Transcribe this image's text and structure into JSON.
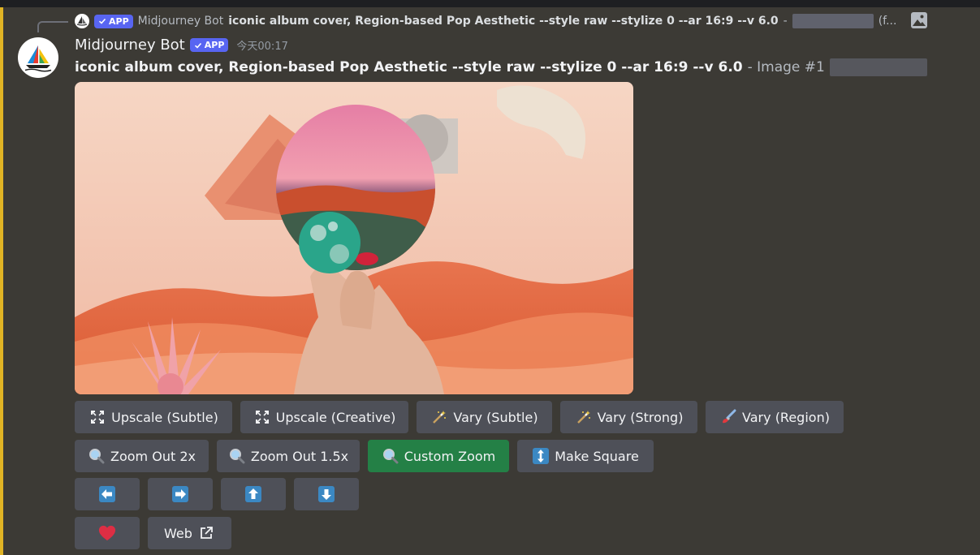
{
  "reply": {
    "badge": "APP",
    "author": "Midjourney Bot",
    "prompt": "iconic album cover, Region-based Pop Aesthetic --style raw --stylize 0 --ar 16:9 --v 6.0",
    "separator": "-",
    "more": "(f..."
  },
  "message": {
    "author": "Midjourney Bot",
    "badge": "APP",
    "timestamp": "今天00:17",
    "prompt": "iconic album cover, Region-based Pop Aesthetic --style raw --stylize 0 --ar 16:9 --v 6.0",
    "image_label": "- Image #1"
  },
  "buttons": {
    "row1": [
      {
        "label": "Upscale (Subtle)",
        "icon": "expand-icon"
      },
      {
        "label": "Upscale (Creative)",
        "icon": "expand-icon"
      },
      {
        "label": "Vary (Subtle)",
        "icon": "magic-wand-icon"
      },
      {
        "label": "Vary (Strong)",
        "icon": "magic-wand-icon"
      },
      {
        "label": "Vary (Region)",
        "icon": "paintbrush-icon"
      }
    ],
    "row2": [
      {
        "label": "Zoom Out 2x",
        "icon": "magnifier-icon"
      },
      {
        "label": "Zoom Out 1.5x",
        "icon": "magnifier-icon"
      },
      {
        "label": "Custom Zoom",
        "icon": "magnifier-icon"
      },
      {
        "label": "Make Square",
        "icon": "up-down-arrow-icon"
      }
    ],
    "web_label": "Web"
  },
  "colors": {
    "background": "#3c3a35",
    "accent": "#e0b324",
    "button": "#4e5058",
    "button_success": "#248046",
    "badge": "#5865f2"
  }
}
